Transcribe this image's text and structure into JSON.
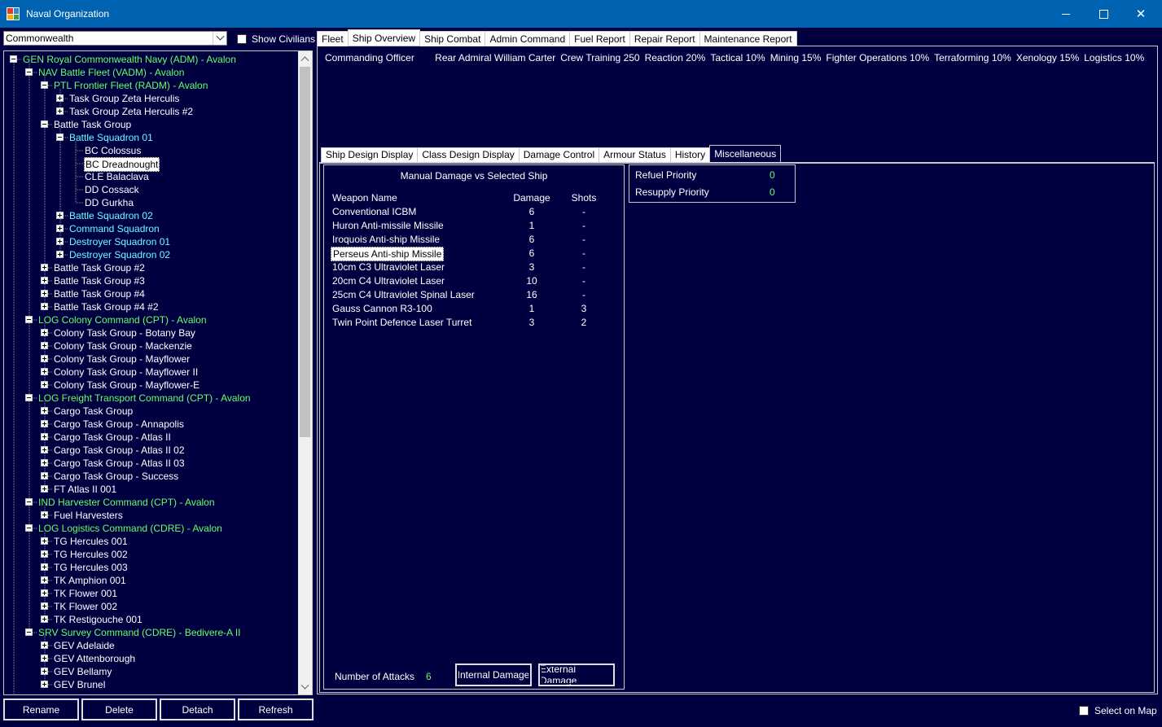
{
  "window": {
    "title": "Naval Organization"
  },
  "left": {
    "race_select": "Commonwealth",
    "show_civilians_label": "Show Civilians",
    "tree": [
      {
        "depth": 0,
        "exp": "minus",
        "label": "GEN Royal Commonwealth Navy  (ADM)  -  Avalon",
        "color": "green"
      },
      {
        "depth": 1,
        "exp": "minus",
        "label": "NAV Battle Fleet  (VADM)  -  Avalon",
        "color": "green"
      },
      {
        "depth": 2,
        "exp": "minus",
        "label": "PTL Frontier Fleet  (RADM)  -  Avalon",
        "color": "green"
      },
      {
        "depth": 3,
        "exp": "plus",
        "label": "Task Group Zeta Herculis",
        "color": "white"
      },
      {
        "depth": 3,
        "exp": "plus",
        "label": "Task Group Zeta Herculis #2",
        "color": "white"
      },
      {
        "depth": 2,
        "exp": "minus",
        "label": "Battle Task Group",
        "color": "white"
      },
      {
        "depth": 3,
        "exp": "minus",
        "label": "Battle Squadron 01",
        "color": "cyan"
      },
      {
        "depth": 4,
        "exp": "none",
        "label": "BC Colossus",
        "color": "white"
      },
      {
        "depth": 4,
        "exp": "none",
        "label": "BC Dreadnought",
        "color": "white",
        "selected": true
      },
      {
        "depth": 4,
        "exp": "none",
        "label": "CLE Balaclava",
        "color": "white"
      },
      {
        "depth": 4,
        "exp": "none",
        "label": "DD Cossack",
        "color": "white"
      },
      {
        "depth": 4,
        "exp": "none",
        "label": "DD Gurkha",
        "color": "white"
      },
      {
        "depth": 3,
        "exp": "plus",
        "label": "Battle Squadron 02",
        "color": "cyan"
      },
      {
        "depth": 3,
        "exp": "plus",
        "label": "Command Squadron",
        "color": "cyan"
      },
      {
        "depth": 3,
        "exp": "plus",
        "label": "Destroyer Squadron 01",
        "color": "cyan"
      },
      {
        "depth": 3,
        "exp": "plus",
        "label": "Destroyer Squadron 02",
        "color": "cyan"
      },
      {
        "depth": 2,
        "exp": "plus",
        "label": "Battle Task Group #2",
        "color": "white"
      },
      {
        "depth": 2,
        "exp": "plus",
        "label": "Battle Task Group #3",
        "color": "white"
      },
      {
        "depth": 2,
        "exp": "plus",
        "label": "Battle Task Group #4",
        "color": "white"
      },
      {
        "depth": 2,
        "exp": "plus",
        "label": "Battle Task Group #4 #2",
        "color": "white"
      },
      {
        "depth": 1,
        "exp": "minus",
        "label": "LOG Colony Command  (CPT)  -  Avalon",
        "color": "green"
      },
      {
        "depth": 2,
        "exp": "plus",
        "label": "Colony Task Group - Botany Bay",
        "color": "white"
      },
      {
        "depth": 2,
        "exp": "plus",
        "label": "Colony Task Group - Mackenzie",
        "color": "white"
      },
      {
        "depth": 2,
        "exp": "plus",
        "label": "Colony Task Group - Mayflower",
        "color": "white"
      },
      {
        "depth": 2,
        "exp": "plus",
        "label": "Colony Task Group - Mayflower II",
        "color": "white"
      },
      {
        "depth": 2,
        "exp": "plus",
        "label": "Colony Task Group - Mayflower-E",
        "color": "white"
      },
      {
        "depth": 1,
        "exp": "minus",
        "label": "LOG Freight Transport Command  (CPT)  -  Avalon",
        "color": "green"
      },
      {
        "depth": 2,
        "exp": "plus",
        "label": "Cargo Task Group",
        "color": "white"
      },
      {
        "depth": 2,
        "exp": "plus",
        "label": "Cargo Task Group - Annapolis",
        "color": "white"
      },
      {
        "depth": 2,
        "exp": "plus",
        "label": "Cargo Task Group - Atlas II",
        "color": "white"
      },
      {
        "depth": 2,
        "exp": "plus",
        "label": "Cargo Task Group - Atlas II 02",
        "color": "white"
      },
      {
        "depth": 2,
        "exp": "plus",
        "label": "Cargo Task Group - Atlas II 03",
        "color": "white"
      },
      {
        "depth": 2,
        "exp": "plus",
        "label": "Cargo Task Group - Success",
        "color": "white"
      },
      {
        "depth": 2,
        "exp": "plus",
        "label": "FT Atlas II 001",
        "color": "white"
      },
      {
        "depth": 1,
        "exp": "minus",
        "label": "IND Harvester Command  (CPT)  -  Avalon",
        "color": "green"
      },
      {
        "depth": 2,
        "exp": "plus",
        "label": "Fuel Harvesters",
        "color": "white"
      },
      {
        "depth": 1,
        "exp": "minus",
        "label": "LOG Logistics Command  (CDRE)  -  Avalon",
        "color": "green"
      },
      {
        "depth": 2,
        "exp": "plus",
        "label": "TG Hercules 001",
        "color": "white"
      },
      {
        "depth": 2,
        "exp": "plus",
        "label": "TG Hercules 002",
        "color": "white"
      },
      {
        "depth": 2,
        "exp": "plus",
        "label": "TG Hercules 003",
        "color": "white"
      },
      {
        "depth": 2,
        "exp": "plus",
        "label": "TK Amphion 001",
        "color": "white"
      },
      {
        "depth": 2,
        "exp": "plus",
        "label": "TK Flower 001",
        "color": "white"
      },
      {
        "depth": 2,
        "exp": "plus",
        "label": "TK Flower 002",
        "color": "white"
      },
      {
        "depth": 2,
        "exp": "plus",
        "label": "TK Restigouche 001",
        "color": "white"
      },
      {
        "depth": 1,
        "exp": "minus",
        "label": "SRV Survey Command  (CDRE)  -  Bedivere-A II",
        "color": "green"
      },
      {
        "depth": 2,
        "exp": "plus",
        "label": "GEV Adelaide",
        "color": "white"
      },
      {
        "depth": 2,
        "exp": "plus",
        "label": "GEV Attenborough",
        "color": "white"
      },
      {
        "depth": 2,
        "exp": "plus",
        "label": "GEV Bellamy",
        "color": "white"
      },
      {
        "depth": 2,
        "exp": "plus",
        "label": "GEV Brunel",
        "color": "white"
      }
    ],
    "buttons": {
      "rename": "Rename",
      "delete": "Delete",
      "detach": "Detach",
      "refresh": "Refresh"
    }
  },
  "top_tabs": [
    {
      "label": "Fleet",
      "active": false
    },
    {
      "label": "Ship Overview",
      "active": true
    },
    {
      "label": "Ship Combat",
      "active": false
    },
    {
      "label": "Admin Command",
      "active": false
    },
    {
      "label": "Fuel Report",
      "active": false
    },
    {
      "label": "Repair Report",
      "active": false
    },
    {
      "label": "Maintenance Report",
      "active": false
    }
  ],
  "officer": {
    "label": "Commanding Officer",
    "values": [
      "Rear Admiral William Carter",
      "Crew Training 250",
      "Reaction 20%",
      "Tactical 10%",
      "Mining 15%",
      "Fighter Operations 10%",
      "Terraforming 10%",
      "Xenology 15%",
      "Logistics 10%"
    ]
  },
  "sub_tabs": [
    {
      "label": "Ship Design Display",
      "active": false
    },
    {
      "label": "Class Design Display",
      "active": false
    },
    {
      "label": "Damage Control",
      "active": false
    },
    {
      "label": "Armour Status",
      "active": false
    },
    {
      "label": "History",
      "active": false
    },
    {
      "label": "Miscellaneous",
      "active": true
    }
  ],
  "damage": {
    "title": "Manual Damage vs Selected Ship",
    "headers": {
      "name": "Weapon Name",
      "damage": "Damage",
      "shots": "Shots"
    },
    "rows": [
      {
        "name": "Conventional ICBM",
        "damage": "6",
        "shots": "-"
      },
      {
        "name": "Huron Anti-missile Missile",
        "damage": "1",
        "shots": "-"
      },
      {
        "name": "Iroquois Anti-ship Missile",
        "damage": "6",
        "shots": "-"
      },
      {
        "name": "Perseus Anti-ship Missile",
        "damage": "6",
        "shots": "-",
        "selected": true
      },
      {
        "name": "10cm C3 Ultraviolet Laser",
        "damage": "3",
        "shots": "-"
      },
      {
        "name": "20cm C4 Ultraviolet Laser",
        "damage": "10",
        "shots": "-"
      },
      {
        "name": "25cm C4 Ultraviolet Spinal Laser",
        "damage": "16",
        "shots": "-"
      },
      {
        "name": "Gauss Cannon R3-100",
        "damage": "1",
        "shots": "3"
      },
      {
        "name": "Twin Point Defence Laser Turret",
        "damage": "3",
        "shots": "2"
      }
    ],
    "attacks_label": "Number of Attacks",
    "attacks_value": "6",
    "internal_label": "Internal Damage",
    "external_label": "External Damage"
  },
  "priority": {
    "refuel_label": "Refuel Priority",
    "refuel_value": "0",
    "resupply_label": "Resupply Priority",
    "resupply_value": "0"
  },
  "select_on_map_label": "Select on Map",
  "colors": {
    "background": "#000040",
    "titlebar": "#0063b1",
    "green": "#66ff66",
    "cyan": "#66ffff"
  }
}
